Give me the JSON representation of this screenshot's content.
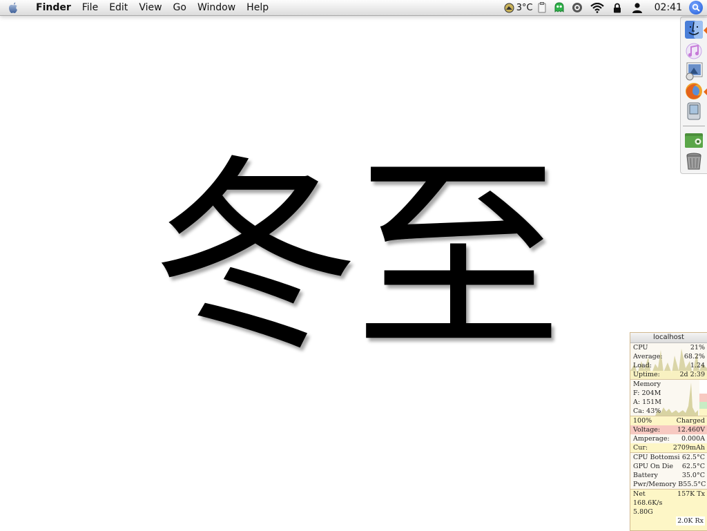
{
  "menubar": {
    "app_name": "Finder",
    "menus": [
      "File",
      "Edit",
      "View",
      "Go",
      "Window",
      "Help"
    ],
    "temperature": "3°C",
    "clock": "02:41",
    "status_icons": [
      "weather-icon",
      "clipboard-icon",
      "alien-icon",
      "circle-icon",
      "wifi-icon",
      "lock-icon",
      "user-icon",
      "spotlight-icon"
    ]
  },
  "wallpaper": {
    "text": "冬至"
  },
  "dock": {
    "icons": [
      "finder-icon",
      "itunes-icon",
      "preview-icon",
      "firefox-icon",
      "pda-icon",
      "folder-icon",
      "trash-icon"
    ]
  },
  "istat": {
    "title": "localhost",
    "cpu": {
      "label": "CPU",
      "value": "21%",
      "average_label": "Average:",
      "average_value": "68.2%",
      "load_label": "Load:",
      "load_value": "1.24",
      "uptime_label": "Uptime:",
      "uptime_value": "2d 2:39"
    },
    "memory": {
      "label": "Memory",
      "free": "F: 204M",
      "active": "A: 151M",
      "cache": "Ca: 43%"
    },
    "battery": {
      "percent": "100%",
      "status": "Charged",
      "voltage_label": "Voltage:",
      "voltage_value": "12.460V",
      "amperage_label": "Amperage:",
      "amperage_value": "0.000A",
      "current_label": "Cur:",
      "current_value": "2709mAh"
    },
    "temps": [
      {
        "label": "CPU Bottomsi",
        "value": "62.5°C"
      },
      {
        "label": "GPU On Die",
        "value": "62.5°C"
      },
      {
        "label": "Battery",
        "value": "35.0°C"
      },
      {
        "label": "Pwr/Memory B",
        "value": "55.5°C"
      }
    ],
    "net": {
      "label": "Net",
      "tx": "157K Tx",
      "rate": "168.6K/s",
      "total": "5.80G",
      "rx": "2.0K Rx"
    }
  },
  "colors": {
    "menubar": "#e9e9e9",
    "istat_yellow": "#fdf6c6",
    "istat_pink": "#f7c9c1",
    "graph_fill": "#cfc98f"
  }
}
